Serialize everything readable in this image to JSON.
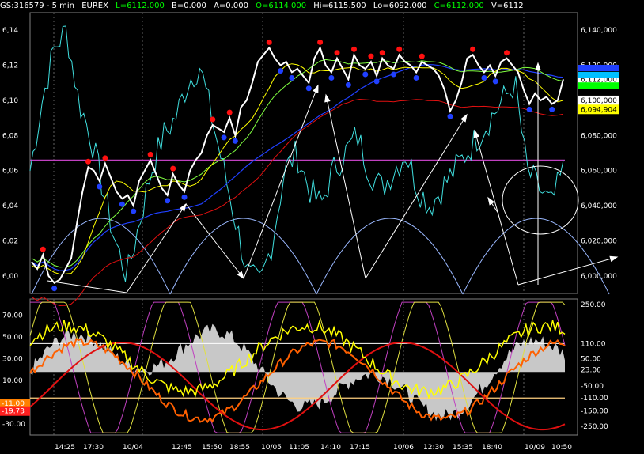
{
  "header": {
    "symbol": "GS:316579 - 5 min",
    "exchange": "EUREX",
    "last": "L=6112.000",
    "bid": "B=0.000",
    "ask": "A=0.000",
    "open": "O=6114.000",
    "high": "Hi=6115.500",
    "low": "Lo=6092.000",
    "close": "C=6112.000",
    "volume": "V=6112"
  },
  "colors": {
    "up": "#00ff00",
    "price": "#ffffff",
    "cyan": "#40e0e0",
    "red": "#e01010",
    "yellow": "#ffff00",
    "green": "#80ff40",
    "blue": "#2040ff",
    "magenta": "#c040c0",
    "orange": "#ff6000",
    "grey": "#c8c8c8"
  },
  "chart_data": [
    {
      "type": "line",
      "panel": "price",
      "y_ticks_left": [
        "6,14",
        "6,12",
        "6,10",
        "6,08",
        "6,06",
        "6,04",
        "6,02",
        "6,00"
      ],
      "y_ticks_right": [
        "6,140,000",
        "6,120,000",
        "6,100,000",
        "6,080,000",
        "6,060,000",
        "6,040,000",
        "6,020,000",
        "6,000,000"
      ],
      "ylim": [
        5990,
        6150
      ],
      "right_badges": [
        {
          "text": "6,112,000",
          "bg": "#ffffff",
          "fg": "#000000",
          "value": 6112
        },
        {
          "text": "6,100,000",
          "bg": "#ffffff",
          "fg": "#000000",
          "value": 6100
        },
        {
          "text": "6,094,904",
          "bg": "#ffff00",
          "fg": "#000000",
          "value": 6094.9
        }
      ],
      "reference_line": 6066,
      "price_series": [
        6008,
        6004,
        6012,
        6000,
        5996,
        5998,
        6004,
        6010,
        6030,
        6048,
        6062,
        6060,
        6054,
        6064,
        6056,
        6048,
        6044,
        6046,
        6040,
        6054,
        6060,
        6066,
        6058,
        6050,
        6046,
        6058,
        6052,
        6048,
        6060,
        6066,
        6070,
        6080,
        6086,
        6084,
        6082,
        6090,
        6080,
        6096,
        6100,
        6110,
        6122,
        6126,
        6130,
        6124,
        6120,
        6122,
        6116,
        6118,
        6114,
        6110,
        6124,
        6130,
        6120,
        6116,
        6124,
        6118,
        6112,
        6126,
        6120,
        6118,
        6122,
        6114,
        6124,
        6120,
        6118,
        6126,
        6122,
        6120,
        6116,
        6122,
        6120,
        6118,
        6114,
        6106,
        6094,
        6100,
        6110,
        6124,
        6126,
        6120,
        6116,
        6120,
        6114,
        6122,
        6124,
        6120,
        6116,
        6106,
        6098,
        6104,
        6100,
        6102,
        6098,
        6100,
        6112
      ]
    },
    {
      "type": "line",
      "panel": "oscillator",
      "y_ticks_left": [
        "70.00",
        "50.00",
        "30.00",
        "10.00",
        "-11.00",
        "-19.73",
        "-30.00"
      ],
      "y_ticks_right": [
        "250.00",
        "110.00",
        "50.00",
        "23.06",
        "-50.00",
        "-110.00",
        "-150.00",
        "-250.00"
      ],
      "ylim": [
        -40,
        85
      ],
      "levels": [
        110,
        -110
      ],
      "left_badges": [
        {
          "text": "-11.00",
          "bg": "#ff8000",
          "value": -11
        },
        {
          "text": "-19.73",
          "bg": "#ff2020",
          "value": -19.73
        }
      ],
      "right_badges": [
        {
          "text": "110.00",
          "bg": "#000000",
          "fg": "#ffffff",
          "value": 110
        },
        {
          "text": "23.06",
          "bg": "#000000",
          "fg": "#ffffff",
          "value": 23.06
        },
        {
          "text": "-110.00",
          "bg": "#000000",
          "fg": "#ffffff",
          "value": -110
        }
      ]
    }
  ],
  "x_ticks": [
    "14:25",
    "17:30",
    "10/04",
    "12:45",
    "15:50",
    "18:55",
    "10/05",
    "11:05",
    "14:10",
    "17:15",
    "10/06",
    "12:30",
    "15:35",
    "18:40",
    "10/09",
    "10:50"
  ]
}
